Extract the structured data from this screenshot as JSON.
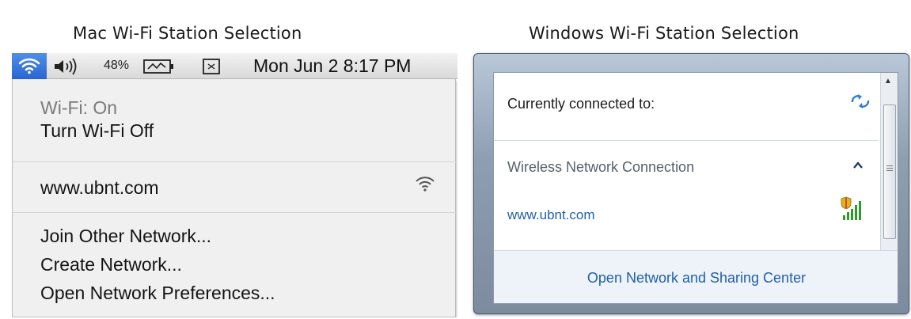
{
  "captions": {
    "mac": "Mac Wi-Fi Station Selection",
    "windows": "Windows Wi-Fi Station Selection"
  },
  "mac": {
    "menubar": {
      "battery_percent": "48%",
      "datetime": "Mon Jun 2  8:17 PM",
      "icons": [
        "wifi-icon",
        "volume-icon",
        "battery-icon",
        "box-icon"
      ]
    },
    "menu": {
      "status": "Wi-Fi: On",
      "toggle": "Turn Wi-Fi Off",
      "network": "www.ubnt.com",
      "join_other": "Join Other Network...",
      "create": "Create Network...",
      "preferences": "Open Network Preferences..."
    },
    "colors": {
      "highlight": "#2a64d2",
      "menu_bg": "#f0f0f0"
    }
  },
  "windows": {
    "currently_connected": "Currently connected to:",
    "connection_title": "Wireless Network Connection",
    "network": "www.ubnt.com",
    "footer_link": "Open Network and Sharing Center",
    "icons": [
      "refresh-icon",
      "chevron-up-icon",
      "signal-shield-icon",
      "scroll-up-icon"
    ],
    "colors": {
      "link": "#1f5fa8",
      "footer_bg": "#eef3f9"
    }
  }
}
